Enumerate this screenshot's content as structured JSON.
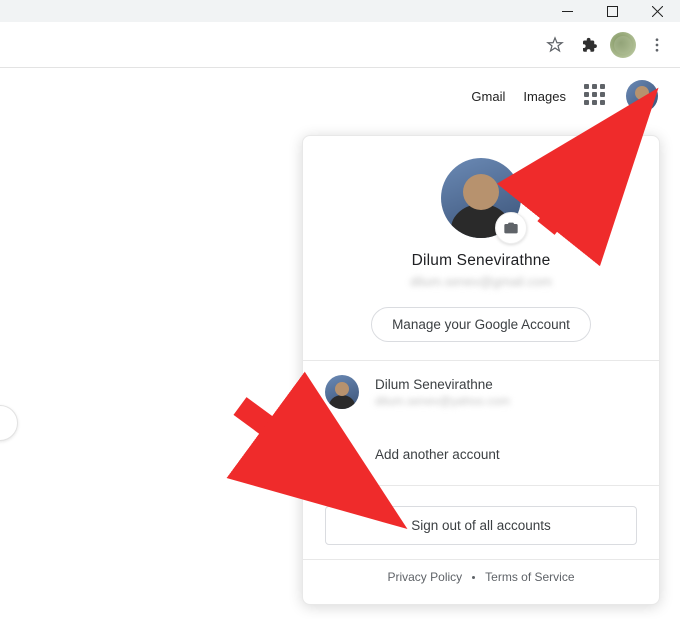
{
  "window": {
    "minimize_tooltip": "Minimize",
    "maximize_tooltip": "Maximize",
    "close_tooltip": "Close"
  },
  "toolbar": {
    "bookmark_tooltip": "Bookmark this page",
    "extensions_tooltip": "Extensions",
    "profile_tooltip": "Profile",
    "menu_tooltip": "Customize and control Google Chrome"
  },
  "googleHeader": {
    "gmail": "Gmail",
    "images": "Images",
    "apps_tooltip": "Google apps",
    "account_tooltip": "Google Account"
  },
  "accountPanel": {
    "camera_tooltip": "Change profile photo",
    "primary": {
      "name": "Dilum Senevirathne",
      "email": "dilum.senev@gmail.com"
    },
    "manage_button": "Manage your Google Account",
    "other_account": {
      "name": "Dilum Senevirathne",
      "email": "dilum.senev@yahoo.com"
    },
    "add_account": "Add another account",
    "sign_out": "Sign out of all accounts",
    "privacy": "Privacy Policy",
    "terms": "Terms of Service"
  }
}
